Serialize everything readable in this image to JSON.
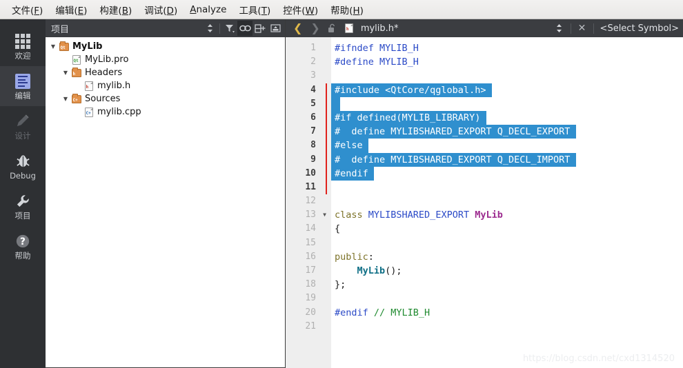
{
  "menu": {
    "items": [
      {
        "label": "文件(F)",
        "mnemonic": "F"
      },
      {
        "label": "编辑(E)",
        "mnemonic": "E"
      },
      {
        "label": "构建(B)",
        "mnemonic": "B"
      },
      {
        "label": "调试(D)",
        "mnemonic": "D"
      },
      {
        "label": "Analyze",
        "mnemonic": "A"
      },
      {
        "label": "工具(T)",
        "mnemonic": "T"
      },
      {
        "label": "控件(W)",
        "mnemonic": "W"
      },
      {
        "label": "帮助(H)",
        "mnemonic": "H"
      }
    ]
  },
  "modebar": {
    "items": [
      {
        "label": "欢迎",
        "icon": "grid-icon",
        "state": "normal"
      },
      {
        "label": "编辑",
        "icon": "document-icon",
        "state": "active"
      },
      {
        "label": "设计",
        "icon": "pencil-icon",
        "state": "disabled"
      },
      {
        "label": "Debug",
        "icon": "bug-icon",
        "state": "normal"
      },
      {
        "label": "项目",
        "icon": "wrench-icon",
        "state": "normal"
      },
      {
        "label": "帮助",
        "icon": "question-mark-icon",
        "state": "normal"
      }
    ]
  },
  "project_panel": {
    "title": "项目",
    "toolbar": [
      {
        "name": "updown-stepper-icon",
        "active": false
      },
      {
        "name": "filter-icon",
        "active": false
      },
      {
        "name": "link-icon",
        "active": true
      },
      {
        "name": "split-add-icon",
        "active": false
      },
      {
        "name": "collapse-icon",
        "active": false
      }
    ],
    "tree": [
      {
        "label": "MyLib",
        "depth": 0,
        "arrow": "▼",
        "icon": "qt-folder-icon",
        "tag": "Qt",
        "bold": true
      },
      {
        "label": "MyLib.pro",
        "depth": 1,
        "arrow": "",
        "icon": "qt-file-icon",
        "tag": "Qt",
        "bold": false
      },
      {
        "label": "Headers",
        "depth": 1,
        "arrow": "▼",
        "icon": "header-folder-icon",
        "tag": "h",
        "bold": false
      },
      {
        "label": "mylib.h",
        "depth": 2,
        "arrow": "",
        "icon": "header-file-icon",
        "tag": "h",
        "bold": false
      },
      {
        "label": "Sources",
        "depth": 1,
        "arrow": "▼",
        "icon": "source-folder-icon",
        "tag": "C+",
        "bold": false
      },
      {
        "label": "mylib.cpp",
        "depth": 2,
        "arrow": "",
        "icon": "source-file-icon",
        "tag": "C+",
        "bold": false
      }
    ]
  },
  "editor_header": {
    "back_arrow": "❮",
    "forward_arrow": "❯",
    "lock_icon": "unlocked-padlock-icon",
    "file_icon": "header-file-icon",
    "filename": "mylib.h*",
    "updown_icon": "updown-stepper-icon",
    "close_icon": "✕",
    "symbol_selector": "<Select Symbol>"
  },
  "editor": {
    "first_line": 1,
    "modified_lines": [
      4,
      5,
      6,
      7,
      8,
      9,
      10,
      11
    ],
    "selected_lines": [
      4,
      5,
      6,
      7,
      8,
      9,
      10
    ],
    "fold_lines": [
      13
    ],
    "lines": [
      {
        "n": 1,
        "tokens": [
          {
            "t": "#ifndef MYLIB_H",
            "c": "t-pre"
          }
        ]
      },
      {
        "n": 2,
        "tokens": [
          {
            "t": "#define MYLIB_H",
            "c": "t-pre"
          }
        ]
      },
      {
        "n": 3,
        "tokens": []
      },
      {
        "n": 4,
        "tokens": [
          {
            "t": "#include <QtCore/qglobal.h>",
            "c": "t-pre"
          }
        ]
      },
      {
        "n": 5,
        "tokens": []
      },
      {
        "n": 6,
        "tokens": [
          {
            "t": "#if defined(MYLIB_LIBRARY)",
            "c": "t-pre"
          }
        ]
      },
      {
        "n": 7,
        "tokens": [
          {
            "t": "#  define MYLIBSHARED_EXPORT Q_DECL_EXPORT",
            "c": "t-pre"
          }
        ]
      },
      {
        "n": 8,
        "tokens": [
          {
            "t": "#else",
            "c": "t-pre"
          }
        ]
      },
      {
        "n": 9,
        "tokens": [
          {
            "t": "#  define MYLIBSHARED_EXPORT Q_DECL_IMPORT",
            "c": "t-pre"
          }
        ]
      },
      {
        "n": 10,
        "tokens": [
          {
            "t": "#endif",
            "c": "t-pre"
          }
        ]
      },
      {
        "n": 11,
        "tokens": []
      },
      {
        "n": 12,
        "tokens": []
      },
      {
        "n": 13,
        "tokens": [
          {
            "t": "class ",
            "c": "t-kw"
          },
          {
            "t": "MYLIBSHARED_EXPORT ",
            "c": "t-type"
          },
          {
            "t": "MyLib",
            "c": "t-cls"
          }
        ]
      },
      {
        "n": 14,
        "tokens": [
          {
            "t": "{",
            "c": "t-plain"
          }
        ]
      },
      {
        "n": 15,
        "tokens": []
      },
      {
        "n": 16,
        "tokens": [
          {
            "t": "public",
            "c": "t-kw"
          },
          {
            "t": ":",
            "c": "t-plain"
          }
        ]
      },
      {
        "n": 17,
        "tokens": [
          {
            "t": "    ",
            "c": "t-plain"
          },
          {
            "t": "MyLib",
            "c": "t-fn"
          },
          {
            "t": "();",
            "c": "t-plain"
          }
        ]
      },
      {
        "n": 18,
        "tokens": [
          {
            "t": "};",
            "c": "t-plain"
          }
        ]
      },
      {
        "n": 19,
        "tokens": []
      },
      {
        "n": 20,
        "tokens": [
          {
            "t": "#endif ",
            "c": "t-pre"
          },
          {
            "t": "// MYLIB_H",
            "c": "t-cmt"
          }
        ]
      },
      {
        "n": 21,
        "tokens": []
      }
    ]
  },
  "watermark": "https://blog.csdn.net/cxd1314520",
  "colors": {
    "menubar_bg": "#eeedeb",
    "panel_header_bg": "#3b3d41",
    "modebar_bg": "#2e3033",
    "mode_active_bg": "#3b3d41",
    "gutter_bg": "#eeeeee",
    "selection_bg": "#2f8fce",
    "modified_marker": "#e0221c",
    "nav_active": "#e0b94a",
    "preprocessor": "#2b4ac7",
    "keyword": "#7d7329",
    "class_name": "#9c2b8f",
    "function_name": "#0f6f86",
    "comment": "#1f8a2f"
  }
}
